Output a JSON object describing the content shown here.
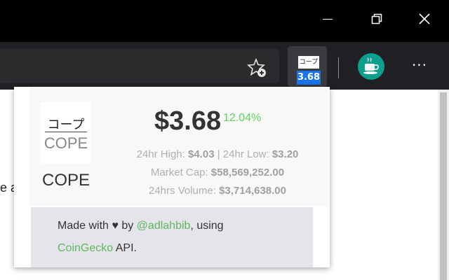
{
  "colors": {
    "titlebar_bg": "#000000",
    "toolbar_bg": "#202124",
    "price_badge_bg": "#1a73e8",
    "change_positive": "#5fd35f",
    "link": "#5fb85f",
    "footer_bg": "#e4e4ea"
  },
  "window_controls": {
    "minimize_icon": "minimize-icon",
    "maximize_icon": "restore-icon",
    "close_icon": "close-icon"
  },
  "toolbar": {
    "favorites_icon": "star-add-icon",
    "extension": {
      "badge_top_text": "コープ",
      "badge_price_text": "3.68"
    },
    "profile_icon": "coffee-cup-icon",
    "more_label": "···"
  },
  "page": {
    "partial_text": "e a"
  },
  "popup": {
    "logo_jp": "コープ",
    "logo_en": "COPE",
    "symbol": "COPE",
    "price": "$3.68",
    "change": "12.04%",
    "high_label": "24hr High:",
    "high_value": "$4.03",
    "separator": "|",
    "low_label": "24hr Low:",
    "low_value": "$3.20",
    "market_cap_label": "Market Cap:",
    "market_cap_value": "$58,569,252.00",
    "volume_label": "24hrs Volume:",
    "volume_value": "$3,714,638.00",
    "footer": {
      "made_with": "Made with ♥ by",
      "author_link": "@adlahbib",
      "using": ", using",
      "api_link": "CoinGecko",
      "api_suffix": " API."
    }
  }
}
